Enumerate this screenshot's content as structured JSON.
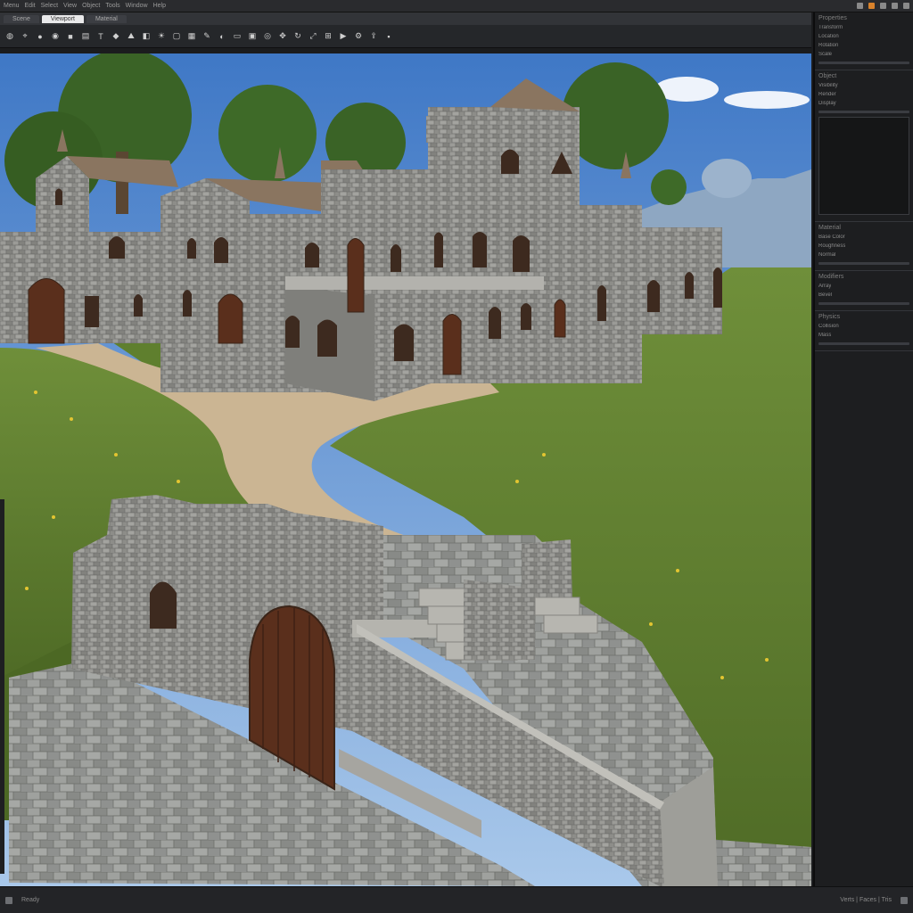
{
  "menubar": {
    "items": [
      "Menu",
      "Edit",
      "Select",
      "View",
      "Object",
      "Tools",
      "Window",
      "Help"
    ],
    "tray_icons": [
      "app-icon",
      "app-icon",
      "app-icon",
      "app-icon",
      "app-icon"
    ]
  },
  "tabs": [
    {
      "label": "Scene",
      "active": false
    },
    {
      "label": "Viewport",
      "active": true
    },
    {
      "label": "Material",
      "active": false
    }
  ],
  "toolbar": {
    "tools": [
      {
        "name": "globe-icon",
        "glyph": "◍"
      },
      {
        "name": "select-icon",
        "glyph": "⌖"
      },
      {
        "name": "sphere-icon",
        "glyph": "●"
      },
      {
        "name": "world-icon",
        "glyph": "◉"
      },
      {
        "name": "cube-icon",
        "glyph": "■"
      },
      {
        "name": "layers-icon",
        "glyph": "▤"
      },
      {
        "name": "text-icon",
        "glyph": "T"
      },
      {
        "name": "shapes-icon",
        "glyph": "◆"
      },
      {
        "name": "terrain-icon",
        "glyph": "⛰"
      },
      {
        "name": "camera-icon",
        "glyph": "◧"
      },
      {
        "name": "light-icon",
        "glyph": "☀"
      },
      {
        "name": "frame-icon",
        "glyph": "▢"
      },
      {
        "name": "grid-icon",
        "glyph": "▦"
      },
      {
        "name": "brush-icon",
        "glyph": "✎"
      },
      {
        "name": "paint-icon",
        "glyph": "◐"
      },
      {
        "name": "eraser-icon",
        "glyph": "▭"
      },
      {
        "name": "image-icon",
        "glyph": "▣"
      },
      {
        "name": "node-icon",
        "glyph": "◎"
      },
      {
        "name": "move-icon",
        "glyph": "✥"
      },
      {
        "name": "rotate-icon",
        "glyph": "↻"
      },
      {
        "name": "scale-icon",
        "glyph": "⤢"
      },
      {
        "name": "snap-icon",
        "glyph": "⊞"
      },
      {
        "name": "render-icon",
        "glyph": "▶"
      },
      {
        "name": "settings-icon",
        "glyph": "⚙"
      },
      {
        "name": "export-icon",
        "glyph": "⇪"
      },
      {
        "name": "save-icon",
        "glyph": "▪"
      }
    ]
  },
  "panel": {
    "sections": [
      {
        "header": "Properties",
        "rows": [
          "Transform",
          "Location",
          "Rotation",
          "Scale"
        ]
      },
      {
        "header": "Object",
        "rows": [
          "Visibility",
          "Render",
          "Display"
        ]
      },
      {
        "header": "Material",
        "rows": [
          "Base Color",
          "Roughness",
          "Normal"
        ]
      },
      {
        "header": "Modifiers",
        "rows": [
          "Array",
          "Bevel"
        ]
      },
      {
        "header": "Physics",
        "rows": [
          "Collision",
          "Mass"
        ]
      }
    ]
  },
  "statusbar": {
    "left": "Ready",
    "right": "Verts | Faces | Tris"
  },
  "colors": {
    "sky": "#6fa3da",
    "grass": "#5c7a2e",
    "stone": "#8c8c88",
    "path": "#cbb593",
    "door": "#5a2f1c",
    "roof": "#8a7560"
  }
}
